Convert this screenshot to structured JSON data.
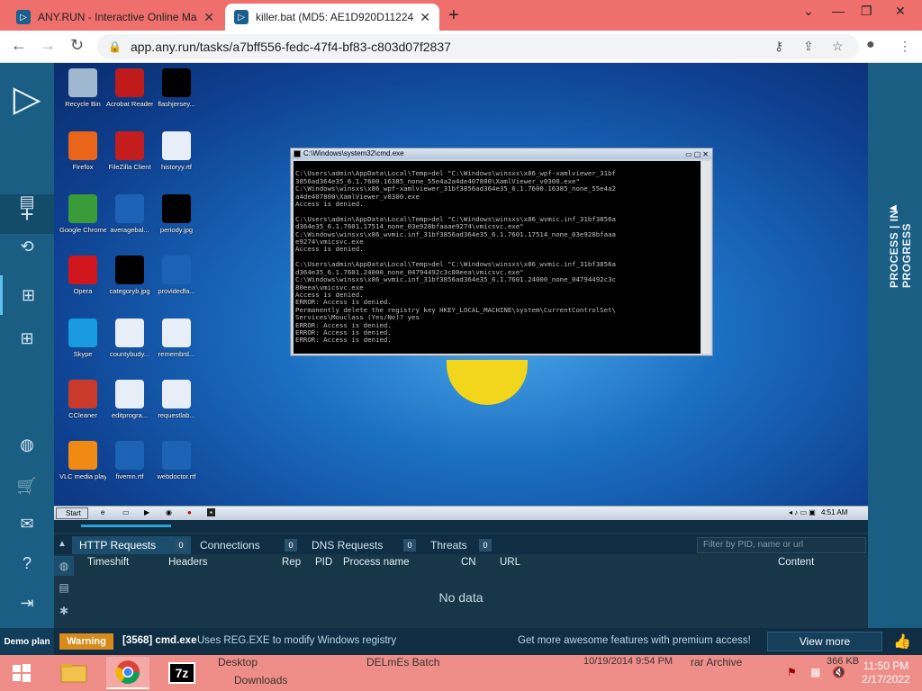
{
  "browser": {
    "tabs": [
      {
        "title": "ANY.RUN - Interactive Online Ma",
        "active": false
      },
      {
        "title": "killer.bat (MD5: AE1D920D11224",
        "active": true
      }
    ],
    "url": "app.any.run/tasks/a7bff556-fedc-47f4-bf83-c803d07f2837"
  },
  "sidebar": {
    "plan_label": "Demo plan",
    "items": [
      "logo-icon",
      "new-task-icon",
      "reports-icon",
      "history-icon",
      "windows-icon",
      "windows-alt-icon",
      "globe-icon",
      "cart-icon",
      "mail-icon",
      "help-icon",
      "logout-icon"
    ]
  },
  "right_strip": {
    "label": "PROCESS | IN PROGRESS"
  },
  "desktop": {
    "icons": [
      {
        "label": "Recycle Bin",
        "color": "#9fb8cf"
      },
      {
        "label": "Acrobat Reader DC",
        "color": "#c01a1a"
      },
      {
        "label": "flashjersey...",
        "color": "#000000"
      },
      {
        "label": "Firefox",
        "color": "#e8651a"
      },
      {
        "label": "FileZilla Client",
        "color": "#c41d1d"
      },
      {
        "label": "historyy.rtf",
        "color": "#e8eef8"
      },
      {
        "label": "Google Chrome",
        "color": "#3a9b3a"
      },
      {
        "label": "averagebal...",
        "color": "#1c63b5"
      },
      {
        "label": "periody.jpg",
        "color": "#000000"
      },
      {
        "label": "Opera",
        "color": "#d0151c"
      },
      {
        "label": "categoryb.jpg",
        "color": "#000000"
      },
      {
        "label": "providedfa...",
        "color": "#1c63b5"
      },
      {
        "label": "Skype",
        "color": "#1a9ae0"
      },
      {
        "label": "countybudy...",
        "color": "#e8eef8"
      },
      {
        "label": "remembrd...",
        "color": "#e8eef8"
      },
      {
        "label": "CCleaner",
        "color": "#c93a2a"
      },
      {
        "label": "editprogra...",
        "color": "#e8eef8"
      },
      {
        "label": "requestlab...",
        "color": "#e8eef8"
      },
      {
        "label": "VLC media player",
        "color": "#f08a12"
      },
      {
        "label": "fivemn.rtf",
        "color": "#1c63b5"
      },
      {
        "label": "webdoctor.rtf",
        "color": "#1c63b5"
      }
    ]
  },
  "cmd": {
    "title": "C:\\Windows\\system32\\cmd.exe",
    "lines": [
      "",
      "C:\\Users\\admin\\AppData\\Local\\Temp>del \"C:\\Windows\\winsxs\\x86_wpf-xamlviewer_31bf",
      "3856ad364e35_6.1.7600.16385_none_55e4a2a4de407800\\XamlViewer_v0300.exe\"",
      "C:\\Windows\\winsxs\\x86_wpf-xamlviewer_31bf3856ad364e35_6.1.7600.16385_none_55e4a2",
      "a4de407800\\XamlViewer_v0300.exe",
      "Access is denied.",
      "",
      "C:\\Users\\admin\\AppData\\Local\\Temp>del \"C:\\Windows\\winsxs\\x86_wvmic.inf_31bf3856a",
      "d364e35_6.1.7601.17514_none_03e928bfaaae9274\\vmicsvc.exe\"",
      "C:\\Windows\\winsxs\\x86_wvmic.inf_31bf3856ad364e35_6.1.7601.17514_none_03e928bfaaa",
      "e9274\\vmicsvc.exe",
      "Access is denied.",
      "",
      "C:\\Users\\admin\\AppData\\Local\\Temp>del \"C:\\Windows\\winsxs\\x86_wvmic.inf_31bf3856a",
      "d364e35_6.1.7601.24000_none_04794492c3c80eea\\vmicsvc.exe\"",
      "C:\\Windows\\winsxs\\x86_wvmic.inf_31bf3856ad364e35_6.1.7601.24000_none_04794492c3c",
      "80eea\\vmicsvc.exe",
      "Access is denied.",
      "ERROR: Access is denied.",
      "Permanently delete the registry key HKEY_LOCAL_MACHINE\\system\\CurrentControlSet\\",
      "Services\\Mouclass (Yes/No)? yes",
      "ERROR: Access is denied.",
      "ERROR: Access is denied.",
      "ERROR: Access is denied."
    ]
  },
  "vm_taskbar": {
    "start_label": "Start",
    "time": "4:51 AM"
  },
  "panel": {
    "tabs": [
      {
        "label": "HTTP Requests",
        "count": "0"
      },
      {
        "label": "Connections",
        "count": "0"
      },
      {
        "label": "DNS Requests",
        "count": "0"
      },
      {
        "label": "Threats",
        "count": "0"
      }
    ],
    "filter_placeholder": "Filter by PID, name or url",
    "columns": [
      "Timeshift",
      "Headers",
      "Rep",
      "PID",
      "Process name",
      "CN",
      "URL",
      "Content"
    ],
    "empty_text": "No data"
  },
  "status": {
    "badge": "Warning",
    "process": "[3568] cmd.exe",
    "message": "Uses REG.EXE to modify Windows registry",
    "promo": "Get more awesome features with premium access!",
    "view_more": "View more"
  },
  "host_taskbar": {
    "files": [
      {
        "name": "Desktop"
      },
      {
        "name": "Downloads"
      },
      {
        "name": "DELmEs Batch"
      },
      {
        "name": "10/19/2014 9:54 PM"
      },
      {
        "name": "rar Archive"
      },
      {
        "name": "366 KB"
      }
    ],
    "time": "11:50 PM",
    "date": "2/17/2022"
  }
}
